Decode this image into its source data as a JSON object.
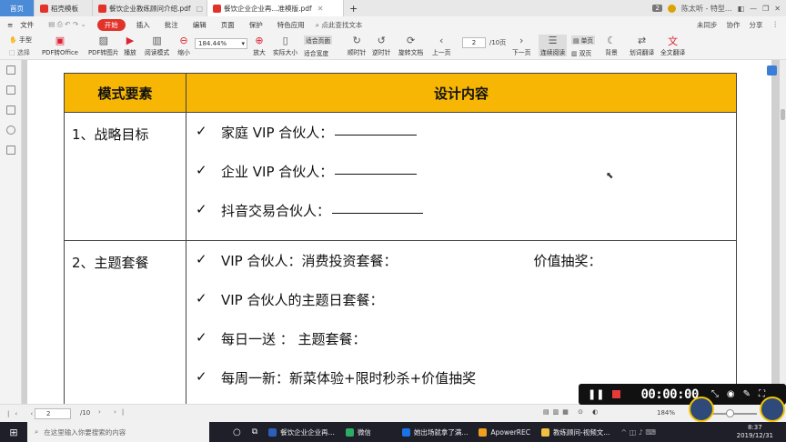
{
  "tabs": [
    {
      "label": "首页",
      "kind": "home"
    },
    {
      "label": "稻壳模板",
      "kind": "normal",
      "color": "#e2332b"
    },
    {
      "label": "餐饮企业教练顾问介绍.pdf",
      "kind": "normal",
      "color": "#e2332b"
    },
    {
      "label": "餐饮企业企业再...准模版.pdf",
      "kind": "active",
      "color": "#e2332b"
    }
  ],
  "tab_new": "+",
  "tabbar_right": {
    "count": "2",
    "user": "陈太听 - 特型..."
  },
  "menu": {
    "file": "文件",
    "items": [
      "开始",
      "插入",
      "批注",
      "编辑",
      "页面",
      "保护",
      "特色应用"
    ],
    "search": "点此查找文本",
    "right": [
      "未同步",
      "协作",
      "分享"
    ]
  },
  "toolbar": {
    "hand": "手型",
    "select": "选择",
    "pdf_office": "PDF转Office",
    "pdf_img": "PDF转图片",
    "play": "播放",
    "read": "阅读模式",
    "zoom_out": "缩小",
    "zoom": "184.44%",
    "zoom_in": "放大",
    "actual": "实际大小",
    "fit_page": "适合页面",
    "fit_width": "适合宽度",
    "rot_cw": "顺时针",
    "rot_ccw": "逆时针",
    "rotate_doc": "旋转文档",
    "prev": "上一页",
    "page": "2",
    "total": "/10页",
    "next": "下一页",
    "continuous": "连续阅读",
    "single": "单页",
    "double": "双页",
    "bg": "背景",
    "translate": "划词翻译",
    "full_translate": "全文翻译"
  },
  "table": {
    "h1": "模式要素",
    "h2": "设计内容",
    "rows": [
      {
        "key": "1、战略目标",
        "lines": [
          "家庭 VIP 合伙人：",
          "企业 VIP 合伙人：",
          "抖音交易合伙人："
        ]
      },
      {
        "key": "2、主题套餐",
        "lines": [
          "VIP 合伙人：消费投资套餐：",
          "VIP 合伙人的主题日套餐：",
          "每日一送 ： 主题套餐：",
          "每周一新：新菜体验+限时秒杀+价值抽奖"
        ],
        "extra": "价值抽奖："
      }
    ],
    "check": "✓"
  },
  "recorder": {
    "time": "00:00:00"
  },
  "status": {
    "page": "2",
    "total": "/10",
    "zoom": "184%"
  },
  "taskbar": {
    "search": "在这里输入你要搜索的内容",
    "apps": [
      {
        "label": "餐饮企业企业再...",
        "color": "#2b5fb8"
      },
      {
        "label": "微信",
        "color": "#2aae67"
      },
      {
        "label": "她出场就拿了满...",
        "color": "#1a73e8"
      },
      {
        "label": "ApowerREC",
        "color": "#f0a020"
      },
      {
        "label": "教练顾问-视频文...",
        "color": "#f0c040"
      }
    ],
    "time": "8:37",
    "date": "2019/12/31"
  }
}
